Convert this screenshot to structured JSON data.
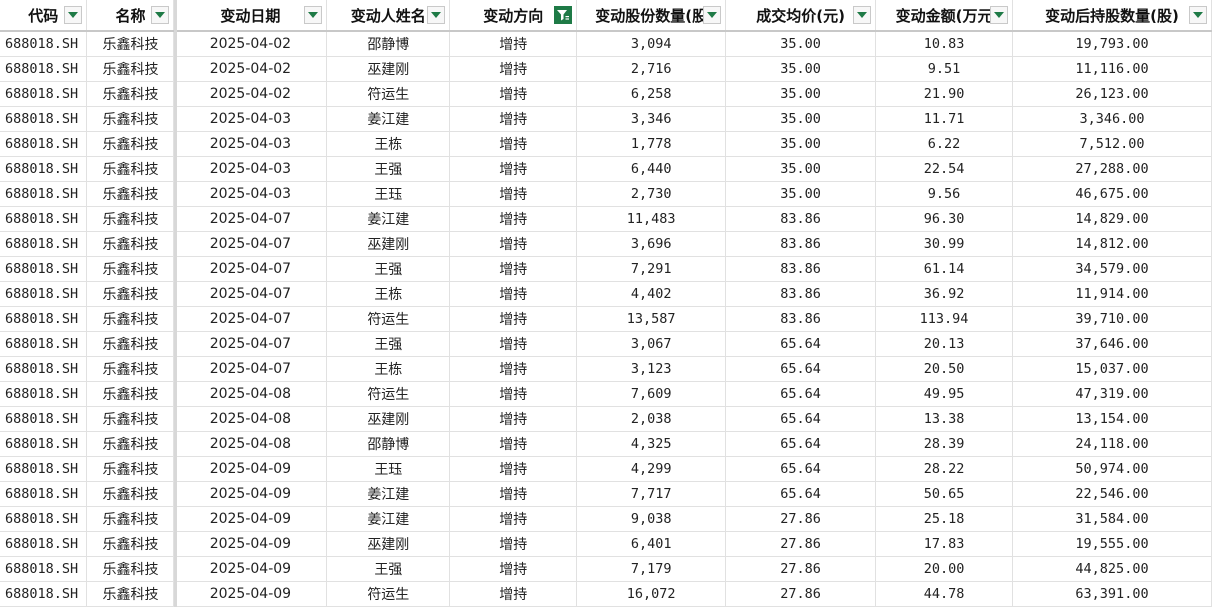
{
  "headers": [
    {
      "label": "代码",
      "filter": "normal"
    },
    {
      "label": "名称",
      "filter": "normal"
    },
    {
      "label": "变动日期",
      "filter": "normal"
    },
    {
      "label": "变动人姓名",
      "filter": "normal"
    },
    {
      "label": "变动方向",
      "filter": "active"
    },
    {
      "label": "变动股份数量(股",
      "filter": "normal"
    },
    {
      "label": "成交均价(元)",
      "filter": "normal"
    },
    {
      "label": "变动金额(万元",
      "filter": "normal"
    },
    {
      "label": "变动后持股数量(股)",
      "filter": "normal"
    }
  ],
  "rows": [
    [
      "688018.SH",
      "乐鑫科技",
      "2025-04-02",
      "邵静博",
      "增持",
      "3,094",
      "35.00",
      "10.83",
      "19,793.00"
    ],
    [
      "688018.SH",
      "乐鑫科技",
      "2025-04-02",
      "巫建刚",
      "增持",
      "2,716",
      "35.00",
      "9.51",
      "11,116.00"
    ],
    [
      "688018.SH",
      "乐鑫科技",
      "2025-04-02",
      "符运生",
      "增持",
      "6,258",
      "35.00",
      "21.90",
      "26,123.00"
    ],
    [
      "688018.SH",
      "乐鑫科技",
      "2025-04-03",
      "姜江建",
      "增持",
      "3,346",
      "35.00",
      "11.71",
      "3,346.00"
    ],
    [
      "688018.SH",
      "乐鑫科技",
      "2025-04-03",
      "王栋",
      "增持",
      "1,778",
      "35.00",
      "6.22",
      "7,512.00"
    ],
    [
      "688018.SH",
      "乐鑫科技",
      "2025-04-03",
      "王强",
      "增持",
      "6,440",
      "35.00",
      "22.54",
      "27,288.00"
    ],
    [
      "688018.SH",
      "乐鑫科技",
      "2025-04-03",
      "王珏",
      "增持",
      "2,730",
      "35.00",
      "9.56",
      "46,675.00"
    ],
    [
      "688018.SH",
      "乐鑫科技",
      "2025-04-07",
      "姜江建",
      "增持",
      "11,483",
      "83.86",
      "96.30",
      "14,829.00"
    ],
    [
      "688018.SH",
      "乐鑫科技",
      "2025-04-07",
      "巫建刚",
      "增持",
      "3,696",
      "83.86",
      "30.99",
      "14,812.00"
    ],
    [
      "688018.SH",
      "乐鑫科技",
      "2025-04-07",
      "王强",
      "增持",
      "7,291",
      "83.86",
      "61.14",
      "34,579.00"
    ],
    [
      "688018.SH",
      "乐鑫科技",
      "2025-04-07",
      "王栋",
      "增持",
      "4,402",
      "83.86",
      "36.92",
      "11,914.00"
    ],
    [
      "688018.SH",
      "乐鑫科技",
      "2025-04-07",
      "符运生",
      "增持",
      "13,587",
      "83.86",
      "113.94",
      "39,710.00"
    ],
    [
      "688018.SH",
      "乐鑫科技",
      "2025-04-07",
      "王强",
      "增持",
      "3,067",
      "65.64",
      "20.13",
      "37,646.00"
    ],
    [
      "688018.SH",
      "乐鑫科技",
      "2025-04-07",
      "王栋",
      "增持",
      "3,123",
      "65.64",
      "20.50",
      "15,037.00"
    ],
    [
      "688018.SH",
      "乐鑫科技",
      "2025-04-08",
      "符运生",
      "增持",
      "7,609",
      "65.64",
      "49.95",
      "47,319.00"
    ],
    [
      "688018.SH",
      "乐鑫科技",
      "2025-04-08",
      "巫建刚",
      "增持",
      "2,038",
      "65.64",
      "13.38",
      "13,154.00"
    ],
    [
      "688018.SH",
      "乐鑫科技",
      "2025-04-08",
      "邵静博",
      "增持",
      "4,325",
      "65.64",
      "28.39",
      "24,118.00"
    ],
    [
      "688018.SH",
      "乐鑫科技",
      "2025-04-09",
      "王珏",
      "增持",
      "4,299",
      "65.64",
      "28.22",
      "50,974.00"
    ],
    [
      "688018.SH",
      "乐鑫科技",
      "2025-04-09",
      "姜江建",
      "增持",
      "7,717",
      "65.64",
      "50.65",
      "22,546.00"
    ],
    [
      "688018.SH",
      "乐鑫科技",
      "2025-04-09",
      "姜江建",
      "增持",
      "9,038",
      "27.86",
      "25.18",
      "31,584.00"
    ],
    [
      "688018.SH",
      "乐鑫科技",
      "2025-04-09",
      "巫建刚",
      "增持",
      "6,401",
      "27.86",
      "17.83",
      "19,555.00"
    ],
    [
      "688018.SH",
      "乐鑫科技",
      "2025-04-09",
      "王强",
      "增持",
      "7,179",
      "27.86",
      "20.00",
      "44,825.00"
    ],
    [
      "688018.SH",
      "乐鑫科技",
      "2025-04-09",
      "符运生",
      "增持",
      "16,072",
      "27.86",
      "44.78",
      "63,391.00"
    ]
  ],
  "colors": {
    "filter_accent": "#1e7a46",
    "grid": "#e1e1e1"
  }
}
